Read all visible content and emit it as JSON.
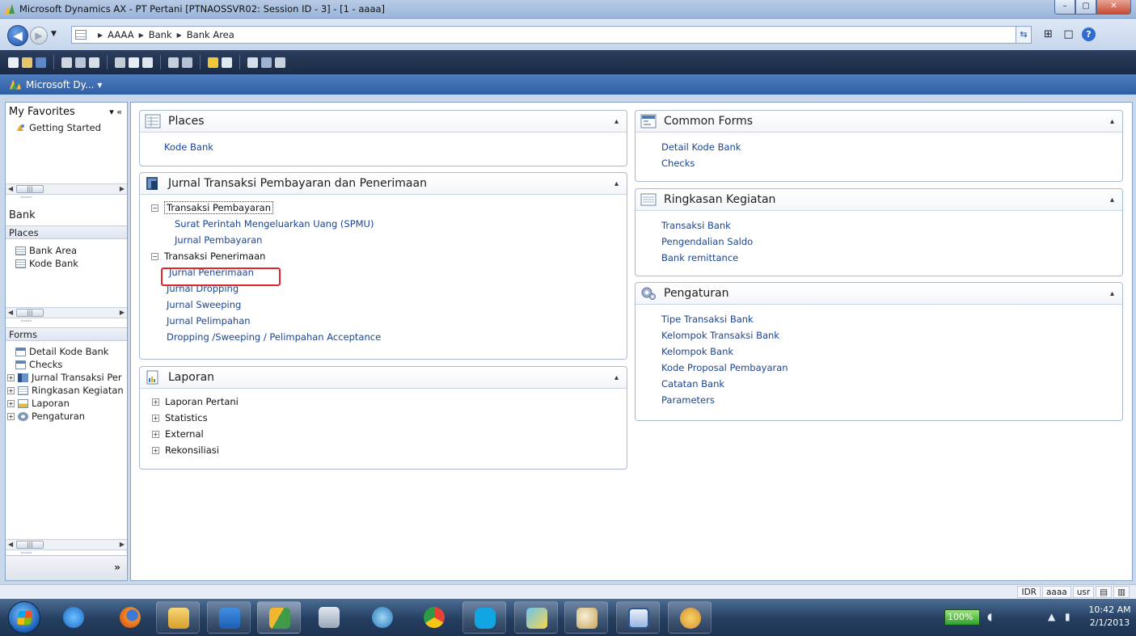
{
  "window": {
    "title": "Microsoft Dynamics AX - PT Pertani [PTNAOSSVR02: Session ID - 3] - [1 - aaaa]",
    "minimize": "–",
    "maximize": "▢",
    "close": "✕"
  },
  "address": {
    "breadcrumbs": [
      "AAAA",
      "Bank",
      "Bank Area"
    ],
    "separator": "▶"
  },
  "appbar": {
    "label": "Microsoft Dy... ▾"
  },
  "nav": {
    "favorites_header": "My Favorites",
    "favorites_controls": "▾ «",
    "favorites": [
      "Getting Started"
    ],
    "module_title": "Bank",
    "places_header": "Places",
    "places": [
      "Bank Area",
      "Kode Bank"
    ],
    "forms_header": "Forms",
    "forms": [
      "Detail Kode Bank",
      "Checks"
    ],
    "form_groups": [
      "Jurnal Transaksi Per",
      "Ringkasan Kegiatan",
      "Laporan",
      "Pengaturan"
    ],
    "expand_more": "»"
  },
  "content": {
    "places": {
      "title": "Places",
      "links": [
        "Kode Bank"
      ]
    },
    "jurnal": {
      "title": "Jurnal Transaksi Pembayaran dan Penerimaan",
      "groups": [
        {
          "label": "Transaksi Pembayaran",
          "items": [
            "Surat Perintah Mengeluarkan Uang (SPMU)",
            "Jurnal Pembayaran"
          ]
        },
        {
          "label": "Transaksi Penerimaan",
          "items": [
            "Jurnal Penerimaan"
          ]
        }
      ],
      "links": [
        "Jurnal Dropping",
        "Jurnal Sweeping",
        "Jurnal Pelimpahan",
        "Dropping /Sweeping / Pelimpahan Acceptance"
      ]
    },
    "laporan": {
      "title": "Laporan",
      "items": [
        "Laporan Pertani",
        "Statistics",
        "External",
        "Rekonsiliasi"
      ]
    },
    "common_forms": {
      "title": "Common Forms",
      "links": [
        "Detail Kode Bank",
        "Checks"
      ]
    },
    "ringkasan": {
      "title": "Ringkasan Kegiatan",
      "links": [
        "Transaksi Bank",
        "Pengendalian Saldo",
        "Bank remittance"
      ]
    },
    "pengaturan": {
      "title": "Pengaturan",
      "links": [
        "Tipe Transaksi Bank",
        "Kelompok Transaksi Bank",
        "Kelompok Bank",
        "Kode Proposal Pembayaran",
        "Catatan Bank",
        "Parameters"
      ]
    },
    "collapse_glyph": "▴"
  },
  "status": {
    "currency": "IDR",
    "company": "aaaa",
    "layer": "usr"
  },
  "taskbar": {
    "battery": "100%",
    "time": "10:42 AM",
    "date": "2/1/2013"
  },
  "colors": {
    "link": "#1a4593",
    "highlight": "#e0262d",
    "appbar": "#3a69ae"
  }
}
